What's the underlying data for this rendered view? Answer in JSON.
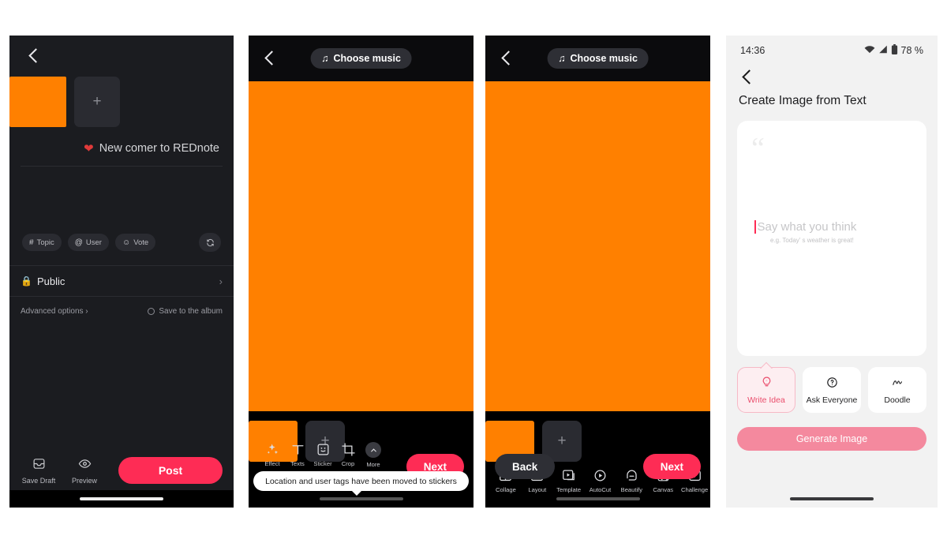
{
  "panel1": {
    "name": "publish-note-screen",
    "back_icon": "back-chevron-icon",
    "add_thumb_label": "+",
    "note_title": "New comer to REDnote",
    "heart_icon": "heart-icon",
    "pills": [
      {
        "icon": "hash-icon",
        "glyph": "#",
        "label": "Topic"
      },
      {
        "icon": "at-icon",
        "glyph": "@",
        "label": "User"
      },
      {
        "icon": "vote-icon",
        "glyph": "☺",
        "label": "Vote"
      }
    ],
    "refresh_icon": "refresh-icon",
    "visibility": {
      "icon": "lock-icon",
      "label": "Public",
      "chevron": "›"
    },
    "advanced_options": "Advanced options ›",
    "save_album": "Save to the album",
    "actions": [
      {
        "icon": "save-draft-icon",
        "label": "Save Draft"
      },
      {
        "icon": "preview-eye-icon",
        "label": "Preview"
      }
    ],
    "post_label": "Post"
  },
  "panel2": {
    "name": "editor-screen-tools",
    "music_label": "Choose music",
    "music_icon": "music-note-icon",
    "add_thumb_label": "+",
    "tooltip": "Location and user tags have been moved to stickers",
    "tools": [
      {
        "icon": "sparkle-effect-icon",
        "label": "Effect"
      },
      {
        "icon": "text-t-icon",
        "label": "Texts"
      },
      {
        "icon": "sticker-face-icon",
        "label": "Sticker"
      },
      {
        "icon": "crop-icon",
        "label": "Crop"
      },
      {
        "icon": "chevron-up-more-icon",
        "label": "More"
      }
    ],
    "next_label": "Next"
  },
  "panel3": {
    "name": "editor-screen-creative",
    "music_label": "Choose music",
    "music_icon": "music-note-icon",
    "add_thumb_label": "+",
    "tools": [
      {
        "icon": "collage-icon",
        "label": "Collage",
        "badge": true
      },
      {
        "icon": "layout-icon",
        "label": "Layout",
        "badge": false
      },
      {
        "icon": "template-icon",
        "label": "Template",
        "badge": false
      },
      {
        "icon": "autocut-icon",
        "label": "AutoCut",
        "badge": false
      },
      {
        "icon": "beautify-icon",
        "label": "Beautify",
        "badge": false
      },
      {
        "icon": "canvas-icon",
        "label": "Canvas",
        "badge": false
      },
      {
        "icon": "challenge-icon",
        "label": "Challenge",
        "badge": false
      }
    ],
    "back_label": "Back",
    "next_label": "Next"
  },
  "panel4": {
    "name": "create-image-from-text-screen",
    "status": {
      "time": "14:36",
      "wifi_icon": "wifi-icon",
      "signal_icon": "signal-icon",
      "battery_icon": "battery-icon",
      "battery_label": "78 %"
    },
    "back_icon": "back-chevron-icon",
    "title": "Create Image from Text",
    "quote_icon": "quote-mark-icon",
    "input_placeholder": "Say what you think",
    "input_hint": "e.g. Today’ s weather is great!",
    "options": [
      {
        "icon": "write-idea-bulb-icon",
        "label": "Write Idea",
        "selected": true
      },
      {
        "icon": "ask-everyone-question-icon",
        "label": "Ask Everyone",
        "selected": false
      },
      {
        "icon": "doodle-scribble-icon",
        "label": "Doodle",
        "selected": false
      }
    ],
    "generate_label": "Generate Image"
  },
  "colors": {
    "orange_canvas": "#ff8000",
    "accent_red": "#fe2c55",
    "dark_bg": "#1b1c20",
    "editor_bg": "#000000",
    "light_bg": "#f2f2f2",
    "pink_accent": "#ea4c6b",
    "pink_button": "#f4899e"
  }
}
